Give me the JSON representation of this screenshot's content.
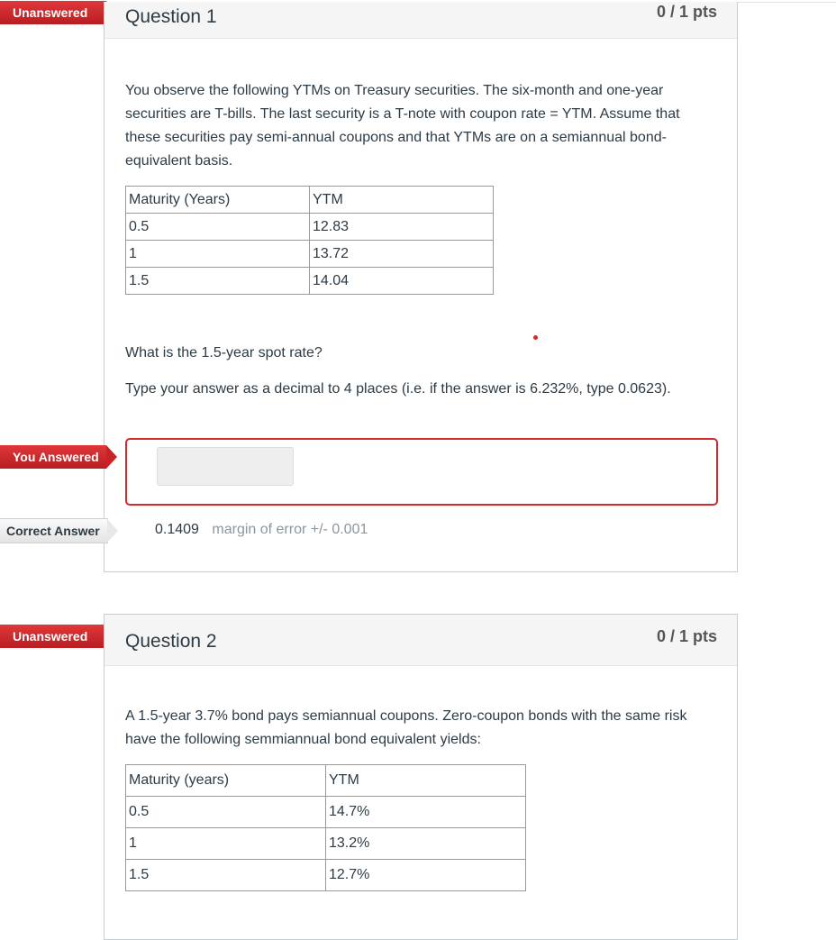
{
  "questions": [
    {
      "status_flag": "Unanswered",
      "title": "Question 1",
      "points": "0 / 1 pts",
      "text": "You observe the following YTMs on Treasury securities. The six-month and one-year securities are T-bills. The last security is a T-note with coupon rate = YTM. Assume that these securities pay semi-annual coupons and that YTMs are on a semiannual bond-equivalent basis.",
      "table": {
        "headers": [
          "Maturity (Years)",
          "YTM"
        ],
        "rows": [
          [
            "0.5",
            "12.83"
          ],
          [
            "1",
            "13.72"
          ],
          [
            "1.5",
            "14.04"
          ]
        ]
      },
      "prompt": "What is the 1.5-year spot rate?",
      "instruction": "Type your answer as a decimal to 4 places (i.e. if the answer is 6.232%, type 0.0623).",
      "you_answered_flag": "You Answered",
      "your_answer": "",
      "correct_answer_flag": "Correct Answer",
      "correct_answer": "0.1409",
      "margin_label": "margin of error",
      "margin_value": "+/- 0.001"
    },
    {
      "status_flag": "Unanswered",
      "title": "Question 2",
      "points": "0 / 1 pts",
      "text": "A 1.5-year 3.7% bond pays semiannual coupons. Zero-coupon bonds with the same risk have the following semmiannual bond equivalent yields:",
      "table": {
        "headers": [
          "Maturity (years)",
          "YTM"
        ],
        "rows": [
          [
            "0.5",
            "14.7%"
          ],
          [
            "1",
            "13.2%"
          ],
          [
            "1.5",
            "12.7%"
          ]
        ]
      }
    }
  ],
  "colors": {
    "incorrect_red": "#d12b2b",
    "header_bg": "#f5f5f5"
  }
}
